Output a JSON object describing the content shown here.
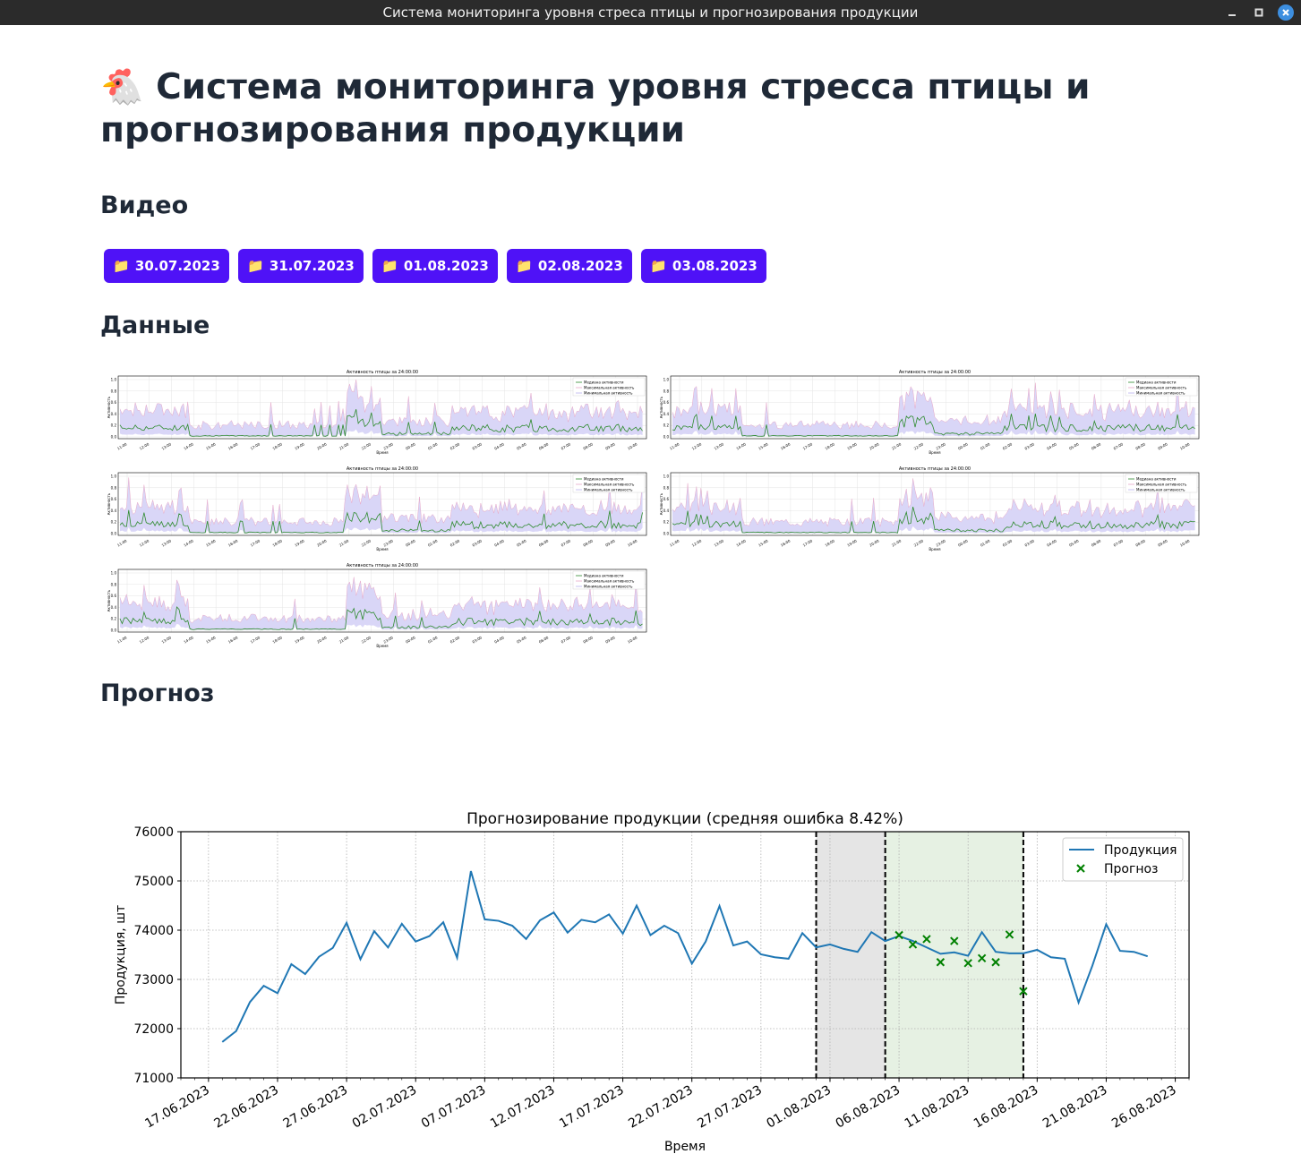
{
  "window": {
    "title": "Система мониторинга уровня стреса птицы и прогнозирования продукции"
  },
  "page": {
    "emoji": "🐔",
    "title": "Система мониторинга уровня стресса птицы и прогнозирования продукции"
  },
  "video": {
    "heading": "Видео",
    "folder_icon": "📁",
    "folders": [
      "30.07.2023",
      "31.07.2023",
      "01.08.2023",
      "02.08.2023",
      "03.08.2023"
    ]
  },
  "data": {
    "heading": "Данные",
    "activity_charts": [
      {
        "title": "Активность птицы за 24:00:00",
        "xlabel": "Время",
        "ylabel": "Активность",
        "legend": [
          "Медиана активности",
          "Максимальная активность",
          "Минимальная активность"
        ]
      },
      {
        "title": "Активность птицы за 24:00:00",
        "xlabel": "Время",
        "ylabel": "Активность",
        "legend": [
          "Медиана активности",
          "Максимальная активность",
          "Минимальная активность"
        ]
      },
      {
        "title": "Активность птицы за 24:00:00",
        "xlabel": "Время",
        "ylabel": "Активность",
        "legend": [
          "Медиана активности",
          "Максимальная активность",
          "Минимальная активность"
        ]
      },
      {
        "title": "Активность птицы за 24:00:00",
        "xlabel": "Время",
        "ylabel": "Активность",
        "legend": [
          "Медиана активности",
          "Максимальная активность",
          "Минимальная активность"
        ]
      },
      {
        "title": "Активность птицы за 24:00:00",
        "xlabel": "Время",
        "ylabel": "Активность",
        "legend": [
          "Медиана активности",
          "Максимальная активность",
          "Минимальная активность"
        ]
      }
    ],
    "activity_ticks": [
      "11:00",
      "12:00",
      "13:00",
      "14:00",
      "15:00",
      "16:00",
      "17:00",
      "18:00",
      "19:00",
      "20:00",
      "21:00",
      "22:00",
      "23:00",
      "00:00",
      "01:00",
      "02:00",
      "03:00",
      "04:00",
      "05:00",
      "06:00",
      "07:00",
      "08:00",
      "09:00",
      "10:00"
    ],
    "activity_yticks": [
      "0.0",
      "0.2",
      "0.4",
      "0.6",
      "0.8",
      "1.0"
    ]
  },
  "forecast": {
    "heading": "Прогноз"
  },
  "chart_data": {
    "type": "line",
    "title": "Прогнозирование продукции (средняя ошибка 8.42%)",
    "xlabel": "Время",
    "ylabel": "Продукция, шт",
    "ylim": [
      71000,
      76000
    ],
    "xlim": [
      "2023-06-15",
      "2023-08-27"
    ],
    "yticks": [
      71000,
      72000,
      73000,
      74000,
      75000,
      76000
    ],
    "xticks": [
      "17.06.2023",
      "22.06.2023",
      "27.06.2023",
      "02.07.2023",
      "07.07.2023",
      "12.07.2023",
      "17.07.2023",
      "22.07.2023",
      "27.07.2023",
      "01.08.2023",
      "06.08.2023",
      "11.08.2023",
      "16.08.2023",
      "21.08.2023",
      "26.08.2023"
    ],
    "grid": true,
    "legend_position": "top-right",
    "shaded_regions": [
      {
        "start": "2023-07-31",
        "end": "2023-08-05",
        "color": "#e5e5e5"
      },
      {
        "start": "2023-08-05",
        "end": "2023-08-15",
        "color": "#e6f1e3"
      }
    ],
    "vlines": [
      "2023-07-31",
      "2023-08-05",
      "2023-08-15"
    ],
    "series": [
      {
        "name": "Продукция",
        "color": "#1f77b4",
        "style": "line",
        "x": [
          "2023-06-18",
          "2023-06-19",
          "2023-06-20",
          "2023-06-21",
          "2023-06-22",
          "2023-06-23",
          "2023-06-24",
          "2023-06-25",
          "2023-06-26",
          "2023-06-27",
          "2023-06-28",
          "2023-06-29",
          "2023-06-30",
          "2023-07-01",
          "2023-07-02",
          "2023-07-03",
          "2023-07-04",
          "2023-07-05",
          "2023-07-06",
          "2023-07-07",
          "2023-07-08",
          "2023-07-09",
          "2023-07-10",
          "2023-07-11",
          "2023-07-12",
          "2023-07-13",
          "2023-07-14",
          "2023-07-15",
          "2023-07-16",
          "2023-07-17",
          "2023-07-18",
          "2023-07-19",
          "2023-07-20",
          "2023-07-21",
          "2023-07-22",
          "2023-07-23",
          "2023-07-24",
          "2023-07-25",
          "2023-07-26",
          "2023-07-27",
          "2023-07-28",
          "2023-07-29",
          "2023-07-30",
          "2023-07-31",
          "2023-08-01",
          "2023-08-02",
          "2023-08-03",
          "2023-08-04",
          "2023-08-05",
          "2023-08-06",
          "2023-08-07",
          "2023-08-08",
          "2023-08-09",
          "2023-08-10",
          "2023-08-11",
          "2023-08-12",
          "2023-08-13",
          "2023-08-14",
          "2023-08-15",
          "2023-08-16",
          "2023-08-17",
          "2023-08-18",
          "2023-08-19",
          "2023-08-20",
          "2023-08-21",
          "2023-08-22",
          "2023-08-23",
          "2023-08-24"
        ],
        "values": [
          71730,
          71950,
          72540,
          72870,
          72720,
          73310,
          73110,
          73460,
          73640,
          74150,
          73410,
          73980,
          73650,
          74130,
          73770,
          73880,
          74160,
          73440,
          75200,
          74220,
          74190,
          74090,
          73820,
          74200,
          74360,
          73950,
          74210,
          74160,
          74320,
          73930,
          74500,
          73900,
          74090,
          73940,
          73320,
          73770,
          74490,
          73690,
          73770,
          73510,
          73450,
          73420,
          73940,
          73650,
          73710,
          73620,
          73560,
          73960,
          73780,
          73880,
          73780,
          73650,
          73520,
          73550,
          73480,
          73960,
          73560,
          73530,
          73530,
          73600,
          73450,
          73420,
          72530,
          73280,
          74120,
          73580,
          73560,
          73470
        ]
      },
      {
        "name": "Прогноз",
        "color": "#008000",
        "style": "scatter",
        "marker": "x",
        "x": [
          "2023-08-06",
          "2023-08-07",
          "2023-08-08",
          "2023-08-09",
          "2023-08-10",
          "2023-08-11",
          "2023-08-12",
          "2023-08-13",
          "2023-08-14",
          "2023-08-15"
        ],
        "values": [
          73900,
          73710,
          73820,
          73350,
          73780,
          73330,
          73430,
          73350,
          73910,
          72760
        ]
      }
    ]
  }
}
